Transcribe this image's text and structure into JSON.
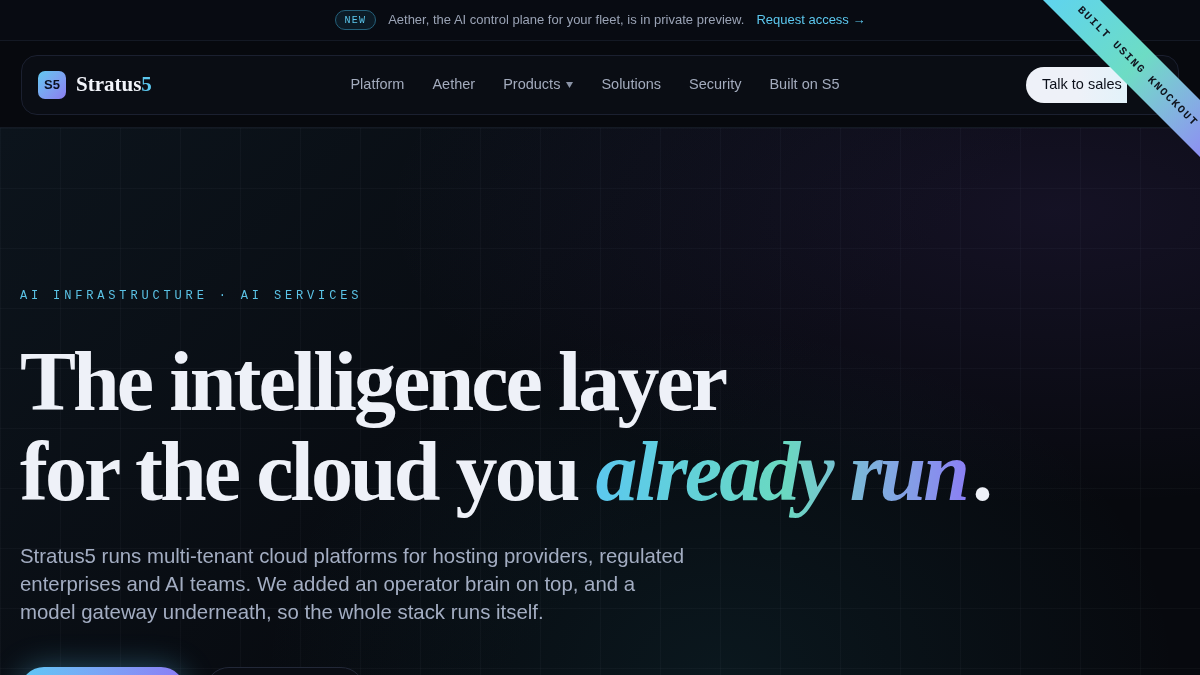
{
  "announcement": {
    "badge": "NEW",
    "text": "Aether, the AI control plane for your fleet, is in private preview.",
    "link": "Request access →"
  },
  "nav": {
    "logo_mark": "S5",
    "brand_name": "Stratus",
    "brand_accent": "5",
    "links": [
      {
        "label": "Platform",
        "kind": "link"
      },
      {
        "label": "Aether",
        "kind": "link"
      },
      {
        "label": "Products",
        "kind": "dropdown"
      },
      {
        "label": "Solutions",
        "kind": "link"
      },
      {
        "label": "Security",
        "kind": "link"
      },
      {
        "label": "Built on S5",
        "kind": "link"
      }
    ],
    "cta": "Talk to sales"
  },
  "ribbon": {
    "text": "BUILT USING KNOCKOUT"
  },
  "hero": {
    "eyebrow": "AI INFRASTRUCTURE · AI SERVICES",
    "headline": {
      "line_1": "The intelligence layer",
      "line_2": "for the cloud you",
      "accent": "already run",
      "end": "."
    },
    "description": "Stratus5 runs multi-tenant cloud platforms for hosting providers, regulated enterprises and AI teams. We added an operator brain on top, and a model gateway underneath, so the whole stack runs itself.",
    "buttons": [
      {
        "kind": "primary"
      },
      {
        "kind": "secondary"
      }
    ]
  }
}
